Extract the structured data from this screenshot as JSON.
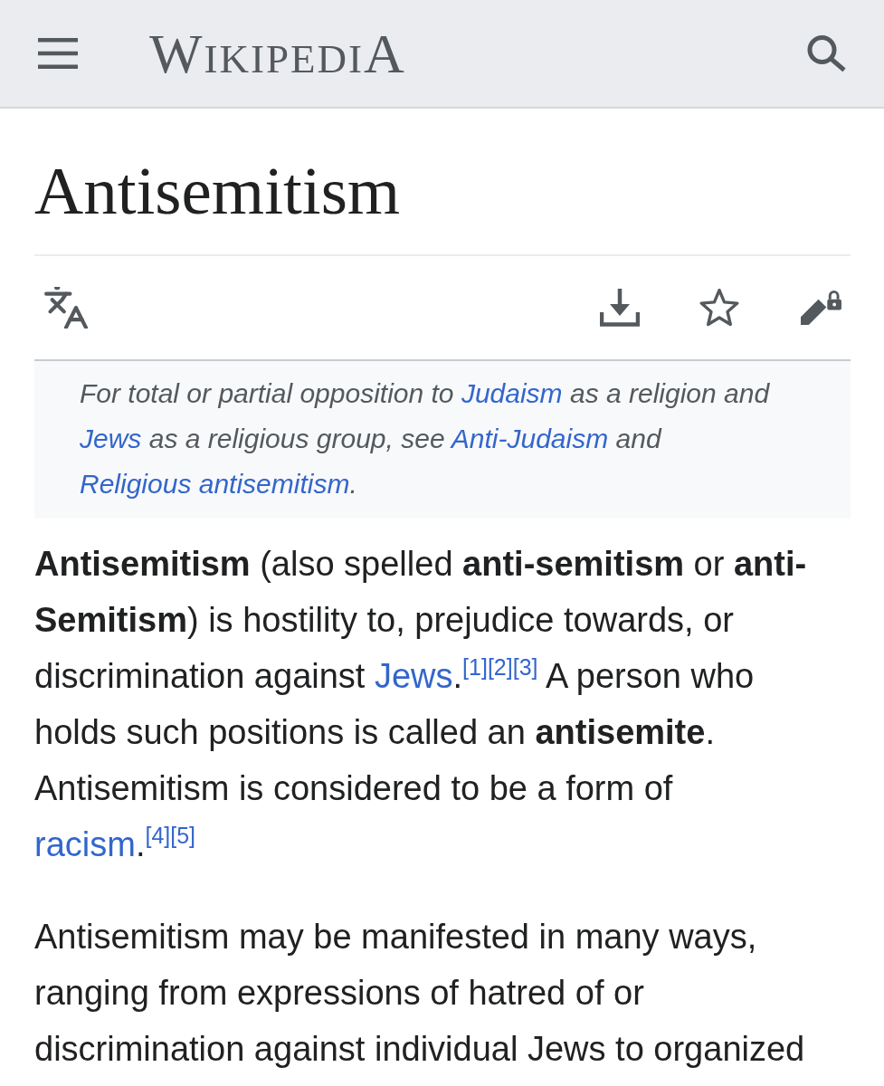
{
  "header": {
    "logo": "WIKIPEDIA"
  },
  "article": {
    "title": "Antisemitism"
  },
  "hatnote": {
    "parts": [
      {
        "kind": "text",
        "text": "For total or partial opposition to "
      },
      {
        "kind": "link",
        "text": "Judaism"
      },
      {
        "kind": "text",
        "text": " as a religion and "
      },
      {
        "kind": "link",
        "text": "Jews"
      },
      {
        "kind": "text",
        "text": " as a religious group, see "
      },
      {
        "kind": "link",
        "text": "Anti-Judaism"
      },
      {
        "kind": "text",
        "text": " and "
      },
      {
        "kind": "link",
        "text": "Religious antisemitism"
      },
      {
        "kind": "text",
        "text": "."
      }
    ]
  },
  "paragraphs": [
    {
      "parts": [
        {
          "kind": "text",
          "text": "**Antisemitism** (also spelled **anti-semitism** or **anti-Semitism**) is hostility to, prejudice towards, or discrimination against "
        },
        {
          "kind": "link",
          "text": "Jews"
        },
        {
          "kind": "text",
          "text": "."
        },
        {
          "kind": "ref",
          "text": "[1]"
        },
        {
          "kind": "ref",
          "text": "[2]"
        },
        {
          "kind": "ref",
          "text": "[3]"
        },
        {
          "kind": "text",
          "text": " A person who holds such positions is called an **antisemite**. Antisemitism is considered to be a form of "
        },
        {
          "kind": "link",
          "text": "racism"
        },
        {
          "kind": "text",
          "text": "."
        },
        {
          "kind": "ref",
          "text": "[4]"
        },
        {
          "kind": "ref",
          "text": "[5]"
        }
      ]
    },
    {
      "parts": [
        {
          "kind": "text",
          "text": "Antisemitism may be manifested in many ways, ranging from expressions of hatred of or discrimination against individual Jews to organized"
        }
      ]
    }
  ]
}
